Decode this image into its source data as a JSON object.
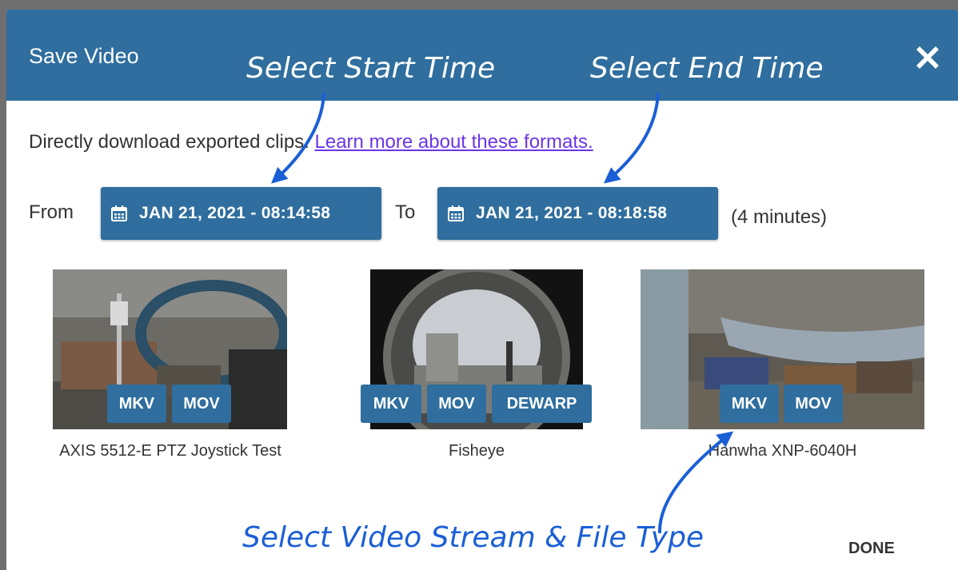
{
  "dialog": {
    "title": "Save Video",
    "close_icon": "close-icon",
    "intro_text": "Directly download exported clips.",
    "learn_more_link": "Learn more about these formats.",
    "from_label": "From",
    "to_label": "To",
    "start_time": "JAN 21, 2021 - 08:14:58",
    "end_time": "JAN 21, 2021 - 08:18:58",
    "duration": "(4 minutes)",
    "calendar_icon": "calendar-icon",
    "done_label": "DONE"
  },
  "cameras": [
    {
      "name": "AXIS 5512-E PTZ Joystick Test",
      "formats": [
        "MKV",
        "MOV"
      ]
    },
    {
      "name": "Fisheye",
      "formats": [
        "MKV",
        "MOV",
        "DEWARP"
      ]
    },
    {
      "name": "Hanwha XNP-6040H",
      "formats": [
        "MKV",
        "MOV"
      ]
    }
  ],
  "annotations": {
    "start": "Select Start Time",
    "end": "Select End Time",
    "stream": "Select Video Stream & File Type"
  },
  "colors": {
    "header": "#2f6e9e",
    "button": "#2f6e9e",
    "link": "#6a35e8",
    "annotation": "#1b5fd6"
  }
}
